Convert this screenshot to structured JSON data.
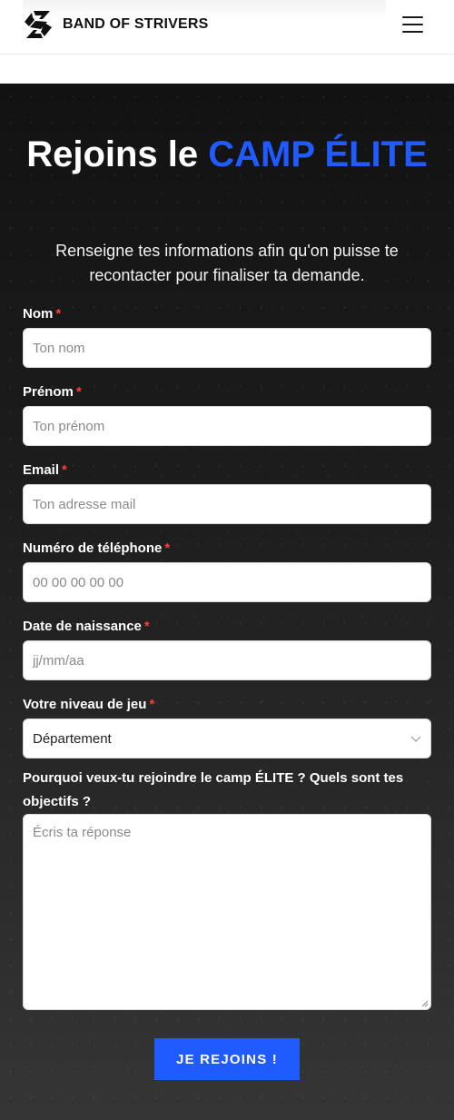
{
  "header": {
    "brand": "BAND OF STRIVERS",
    "menu_icon": "hamburger-menu-icon",
    "logo_icon": "band-of-strivers-logo-icon"
  },
  "form": {
    "title_prefix": "Rejoins le",
    "title_accent": "CAMP ÉLITE",
    "subtitle": "Renseigne tes informations afin qu'on puisse te recontacter pour finaliser ta demande.",
    "required_mark": "*",
    "fields": {
      "nom": {
        "label": "Nom",
        "placeholder": "Ton nom",
        "value": ""
      },
      "prenom": {
        "label": "Prénom",
        "placeholder": "Ton prénom",
        "value": ""
      },
      "email": {
        "label": "Email",
        "placeholder": "Ton adresse mail",
        "value": ""
      },
      "telephone": {
        "label": "Numéro de téléphone",
        "placeholder": "00 00 00 00 00",
        "value": ""
      },
      "naissance": {
        "label": "Date de naissance",
        "placeholder": "jj/mm/aa",
        "value": ""
      },
      "niveau": {
        "label": "Votre niveau de jeu",
        "selected": "Département"
      },
      "objectifs": {
        "label": "Pourquoi veux-tu rejoindre le camp ÉLITE ? Quels sont tes objectifs ?",
        "placeholder": "Écris ta réponse",
        "value": ""
      }
    },
    "submit_label": "JE REJOINS !"
  },
  "colors": {
    "accent": "#1f5bff",
    "required": "#ff3b3b",
    "section_bg": "#1a1a1a"
  }
}
